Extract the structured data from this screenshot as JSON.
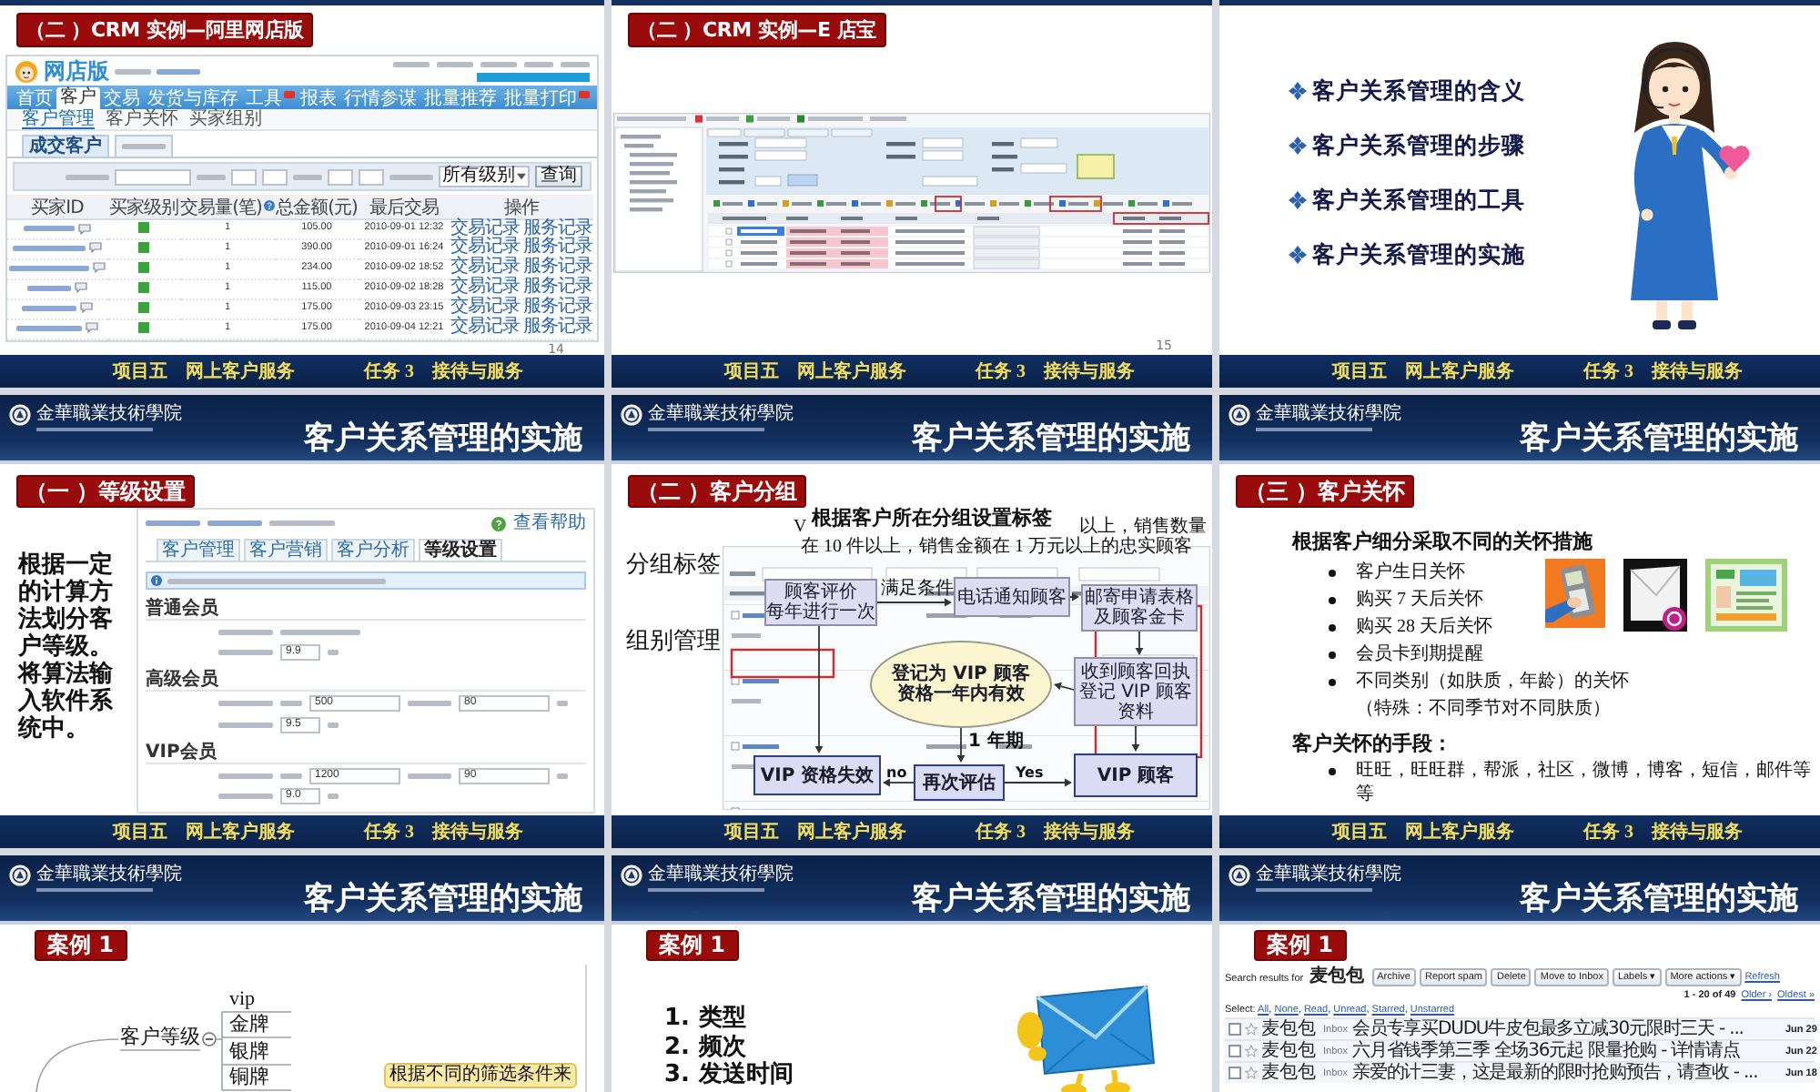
{
  "slides": [
    {
      "kind": "alibaba",
      "tag": "（二 ）CRM 实例—阿里网店版",
      "page_number": "14",
      "shop": {
        "logo": "网店版",
        "nav": [
          {
            "label": "首页",
            "selected": false,
            "badge": false
          },
          {
            "label": "客户",
            "selected": true,
            "badge": false
          },
          {
            "label": "交易",
            "selected": false,
            "badge": false
          },
          {
            "label": "发货与库存",
            "selected": false,
            "badge": false
          },
          {
            "label": "工具",
            "selected": false,
            "badge": true
          },
          {
            "label": "报表",
            "selected": false,
            "badge": false
          },
          {
            "label": "行情参谋",
            "selected": false,
            "badge": false
          },
          {
            "label": "批量推荐",
            "selected": false,
            "badge": false
          },
          {
            "label": "批量打印",
            "selected": false,
            "badge": true
          }
        ],
        "subnav": [
          {
            "label": "客户管理",
            "selected": true
          },
          {
            "label": "客户关怀",
            "selected": false
          },
          {
            "label": "买家组别",
            "selected": false
          }
        ],
        "tabs": [
          {
            "label": "成交客户",
            "selected": true
          },
          {
            "selected": false
          }
        ],
        "filter": {
          "select": "所有级别",
          "button": "查询"
        },
        "columns": [
          {
            "label": "买家ID",
            "help": false
          },
          {
            "label": "买家级别",
            "help": false
          },
          {
            "label": "交易量(笔)",
            "help": true
          },
          {
            "label": "总金额(元)",
            "help": false
          },
          {
            "label": "最后交易",
            "help": false
          },
          {
            "label": "操作",
            "help": false
          }
        ],
        "rows": [
          {
            "count": "1",
            "amount": "105.00",
            "last": "2010-09-01 12:32",
            "links": [
              "交易记录",
              "服务记录"
            ]
          },
          {
            "count": "1",
            "amount": "390.00",
            "last": "2010-09-01 16:24",
            "links": [
              "交易记录",
              "服务记录"
            ]
          },
          {
            "count": "1",
            "amount": "234.00",
            "last": "2010-09-02 18:52",
            "links": [
              "交易记录",
              "服务记录"
            ]
          },
          {
            "count": "1",
            "amount": "115.00",
            "last": "2010-09-02 18:28",
            "links": [
              "交易记录",
              "服务记录"
            ]
          },
          {
            "count": "1",
            "amount": "175.00",
            "last": "2010-09-03 23:15",
            "links": [
              "交易记录",
              "服务记录"
            ]
          },
          {
            "count": "1",
            "amount": "175.00",
            "last": "2010-09-04 12:21",
            "links": [
              "交易记录",
              "服务记录"
            ]
          }
        ]
      },
      "footer": {
        "project": "项目五　网上客户服务",
        "task": "任务 3　接待与服务"
      }
    },
    {
      "kind": "edianbao",
      "tag": "（二 ）CRM 实例—E 店宝",
      "page_number": "15",
      "footer": {
        "project": "项目五　网上客户服务",
        "task": "任务 3　接待与服务"
      }
    },
    {
      "kind": "outline",
      "items": [
        "客户关系管理的含义",
        "客户关系管理的步骤",
        "客户关系管理的工具",
        "客户关系管理的实施"
      ],
      "footer": {
        "project": "项目五　网上客户服务",
        "task": "任务 3　接待与服务"
      }
    },
    {
      "kind": "grading",
      "header": {
        "logo": "金華職業技術學院",
        "title": "客户关系管理的实施"
      },
      "tag": "（一 ）等级设置",
      "text": "根据一定的计算方法划分客户等级。将算法输入软件系统中。",
      "settings": {
        "help": "查看帮助",
        "tabs": [
          {
            "label": "客户管理",
            "selected": false
          },
          {
            "label": "客户营销",
            "selected": false
          },
          {
            "label": "客户分析",
            "selected": false
          },
          {
            "label": "等级设置",
            "selected": true
          }
        ],
        "groups": [
          {
            "title": "普通会员",
            "discount": "9.9"
          },
          {
            "title": "高级会员",
            "thresholds": [
              "500",
              "80"
            ],
            "discount": "9.5"
          },
          {
            "title": "VIP会员",
            "thresholds": [
              "1200",
              "90"
            ],
            "discount": "9.0"
          }
        ]
      },
      "footer": {
        "project": "项目五　网上客户服务",
        "task": "任务 3　接待与服务"
      }
    },
    {
      "kind": "grouping",
      "header": {
        "logo": "金華職業技術學院",
        "title": "客户关系管理的实施"
      },
      "tag": "（二 ）客户分组",
      "labels": [
        "分组标签",
        "组别管理"
      ],
      "headline": "根据客户所在分组设置标签",
      "note": {
        "start": "V",
        "end": "以上，销售数量",
        "line2": "在 10 件以上，销售金额在 1 万元以上的忠实顾客"
      },
      "flow": {
        "nodes": [
          {
            "kind": "note",
            "lines": [
              "顾客评价",
              "每年进行一次"
            ]
          },
          {
            "kind": "note",
            "lines": [
              "电话通知顾客"
            ]
          },
          {
            "kind": "note",
            "lines": [
              "邮寄申请表格",
              "及顾客金卡"
            ]
          },
          {
            "kind": "ellipse",
            "lines": [
              "登记为 VIP 顾客",
              "资格一年内有效"
            ]
          },
          {
            "kind": "note",
            "lines": [
              "收到顾客回执",
              "登记 VIP 顾客资料"
            ]
          },
          {
            "kind": "state",
            "lines": [
              "VIP 资格失效"
            ]
          },
          {
            "kind": "state",
            "lines": [
              "再次评估"
            ]
          },
          {
            "kind": "state",
            "lines": [
              "VIP 顾客"
            ]
          }
        ],
        "labels": [
          "满足条件",
          "1 年期",
          "no",
          "Yes"
        ]
      },
      "footer": {
        "project": "项目五　网上客户服务",
        "task": "任务 3　接待与服务"
      }
    },
    {
      "kind": "care",
      "header": {
        "logo": "金華職業技術學院",
        "title": "客户关系管理的实施"
      },
      "tag": "（三 ）客户关怀",
      "heading": "根据客户细分采取不同的关怀措施",
      "measures": [
        {
          "text": "客户生日关怀",
          "bullet": true
        },
        {
          "text": "购买 7 天后关怀",
          "bullet": true
        },
        {
          "text": "购买 28 天后关怀",
          "bullet": true
        },
        {
          "text": "会员卡到期提醒",
          "bullet": true
        },
        {
          "text": "不同类别（如肤质，年龄）的关怀",
          "bullet": true
        },
        {
          "text": "（特殊：不同季节对不同肤质）",
          "bullet": false
        }
      ],
      "means_title": "客户关怀的手段：",
      "means": [
        "旺旺，旺旺群，帮派，社区，微博，博客，短信，邮件等等"
      ],
      "footer": {
        "project": "项目五　网上客户服务",
        "task": "任务 3　接待与服务"
      }
    },
    {
      "kind": "mindmap",
      "header": {
        "logo": "金華職業技術學院",
        "title": "客户关系管理的实施"
      },
      "tag": "案例 1",
      "root": "客户等级",
      "children": [
        "vip",
        "金牌",
        "银牌",
        "铜牌"
      ],
      "callout": "根据不同的筛选条件来"
    },
    {
      "kind": "steps",
      "header": {
        "logo": "金華職業技術學院",
        "title": "客户关系管理的实施"
      },
      "tag": "案例 1",
      "steps": [
        {
          "number": "1.",
          "text": "类型"
        },
        {
          "number": "2.",
          "text": "频次"
        },
        {
          "number": "3.",
          "text": "发送时间"
        }
      ]
    },
    {
      "kind": "mail",
      "header": {
        "logo": "金華職業技術學院",
        "title": "客户关系管理的实施"
      },
      "tag": "案例 1",
      "search": "Search results for **麦包包**",
      "actions": [
        "Archive",
        "Report spam",
        "Delete",
        "Move to Inbox",
        "Labels ▾",
        "More actions ▾"
      ],
      "refresh": "Refresh",
      "range": "1 - 20 of 49",
      "pager": [
        "Older ›",
        "Oldest »"
      ],
      "select": {
        "label": "Select:",
        "options": [
          "All",
          "None",
          "Read",
          "Unread",
          "Starred",
          "Unstarred"
        ],
        "separator": ", "
      },
      "messages": [
        {
          "checked": false,
          "starred": false,
          "sender": "麦包包",
          "folder": "Inbox",
          "subject": "会员专享买DUDU牛皮包最多立减30元限时三天 - ...",
          "date": "Jun 29"
        },
        {
          "checked": false,
          "starred": false,
          "sender": "麦包包",
          "folder": "Inbox",
          "subject": "六月省钱季第三季 全场36元起 限量抢购 - 详情请点",
          "date": "Jun 22"
        },
        {
          "checked": false,
          "starred": false,
          "sender": "麦包包",
          "folder": "Inbox",
          "subject": "亲爱的计三妻，这是最新的限时抢购预告，请查收 - ...",
          "date": "Jun 18"
        }
      ]
    }
  ]
}
